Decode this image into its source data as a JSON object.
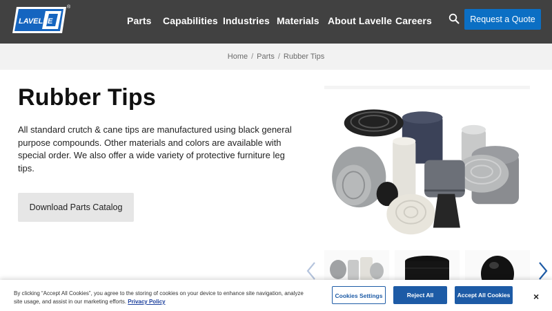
{
  "header": {
    "logo_text": "LAVELLE",
    "logo_mark": "®",
    "nav": [
      "Parts",
      "Capabilities",
      "Industries",
      "Materials",
      "About Lavelle",
      "Careers"
    ],
    "quote_label": "Request a Quote",
    "colors": {
      "bar": "#414141",
      "accent": "#0b6fc4"
    }
  },
  "breadcrumb": [
    "Home",
    "Parts",
    "Rubber Tips"
  ],
  "main": {
    "title": "Rubber Tips",
    "description": "All standard crutch & cane tips are manufactured using black general purpose compounds. Other materials and colors are available with special order. We also offer a wide variety of protective furniture leg tips.",
    "download_label": "Download Parts Catalog"
  },
  "gallery": {
    "icons": [
      "chevron-left-icon",
      "chevron-right-icon"
    ]
  },
  "cookie": {
    "text": "By clicking “Accept All Cookies”, you agree to the storing of cookies on your device to enhance site navigation, analyze site usage, and assist in our marketing efforts.",
    "privacy_label": "Privacy Policy",
    "settings_label": "Cookies Settings",
    "reject_label": "Reject All",
    "accept_label": "Accept All Cookies",
    "close_label": "×"
  }
}
